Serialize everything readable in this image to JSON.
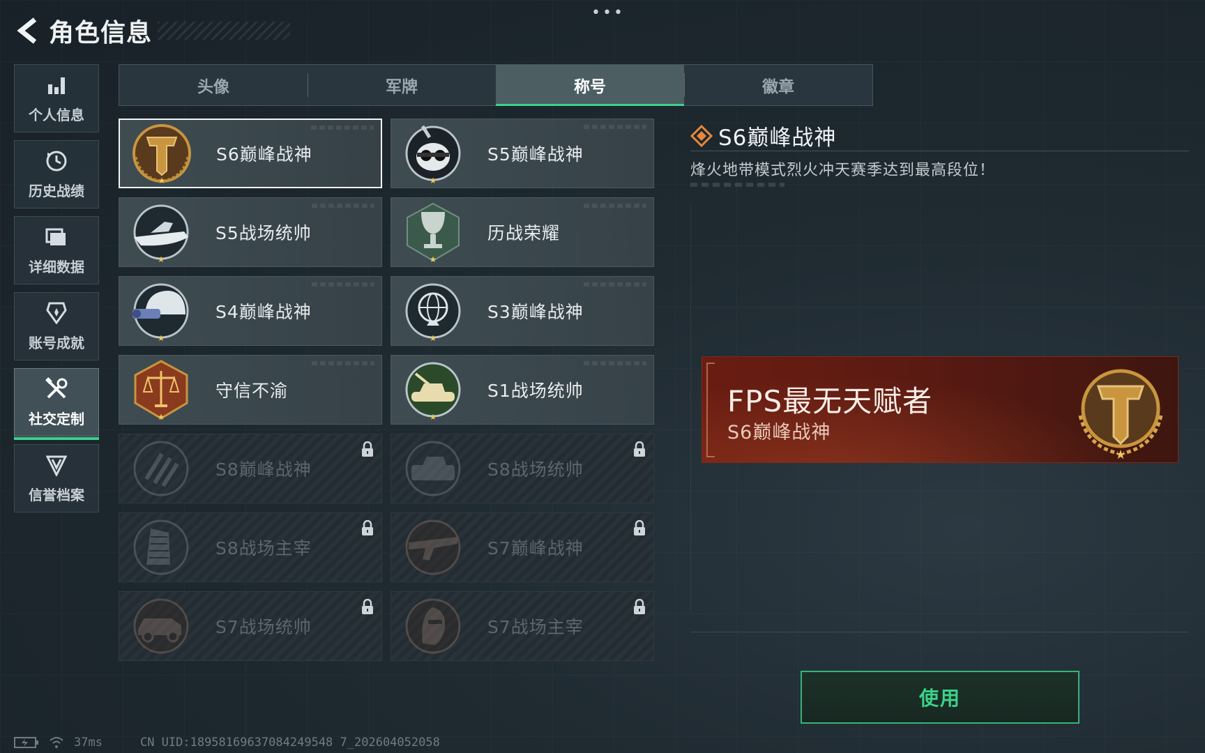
{
  "header": {
    "title": "角色信息"
  },
  "sidebar": {
    "items": [
      {
        "label": "个人信息",
        "icon": "bar-chart-icon"
      },
      {
        "label": "历史战绩",
        "icon": "history-clock-icon"
      },
      {
        "label": "详细数据",
        "icon": "folder-icon"
      },
      {
        "label": "账号成就",
        "icon": "achievement-icon"
      },
      {
        "label": "社交定制",
        "icon": "tools-icon",
        "active": true
      },
      {
        "label": "信誉档案",
        "icon": "credit-shield-icon"
      }
    ]
  },
  "tabs": [
    {
      "label": "头像"
    },
    {
      "label": "军牌"
    },
    {
      "label": "称号",
      "active": true
    },
    {
      "label": "徽章"
    }
  ],
  "titles": [
    {
      "label": "S6巅峰战神",
      "badge": "t-crest-badge",
      "selected": true,
      "locked": false
    },
    {
      "label": "S5巅峰战神",
      "badge": "skull-goggles-badge",
      "locked": false
    },
    {
      "label": "S5战场统帅",
      "badge": "speedboat-badge",
      "locked": false
    },
    {
      "label": "历战荣耀",
      "badge": "trophy-badge",
      "locked": false
    },
    {
      "label": "S4巅峰战神",
      "badge": "helmet-nvg-badge",
      "locked": false
    },
    {
      "label": "S3巅峰战神",
      "badge": "globe-badge",
      "locked": false
    },
    {
      "label": "守信不渝",
      "badge": "scales-badge",
      "locked": false
    },
    {
      "label": "S1战场统帅",
      "badge": "tank-badge",
      "locked": false
    },
    {
      "label": "S8巅峰战神",
      "badge": "stripes-badge",
      "locked": true
    },
    {
      "label": "S8战场统帅",
      "badge": "armored-vehicle-badge",
      "locked": true
    },
    {
      "label": "S8战场主宰",
      "badge": "building-badge",
      "locked": true
    },
    {
      "label": "S7巅峰战神",
      "badge": "rifle-badge",
      "locked": true
    },
    {
      "label": "S7战场统帅",
      "badge": "jeep-badge",
      "locked": true
    },
    {
      "label": "S7战场主宰",
      "badge": "soldier-head-badge",
      "locked": true
    }
  ],
  "detail": {
    "title": "S6巅峰战神",
    "description": "烽火地带模式烈火冲天赛季达到最高段位！",
    "preview_name": "FPS最无天赋者",
    "preview_subtitle": "S6巅峰战神",
    "use_button": "使用"
  },
  "status": {
    "latency": "37ms",
    "uid": "CN UID:18958169637084249548 7_202604052058"
  },
  "colors": {
    "accent_green": "#3bd28a",
    "banner_red": "#6a1d12",
    "gold": "#c9953e"
  }
}
